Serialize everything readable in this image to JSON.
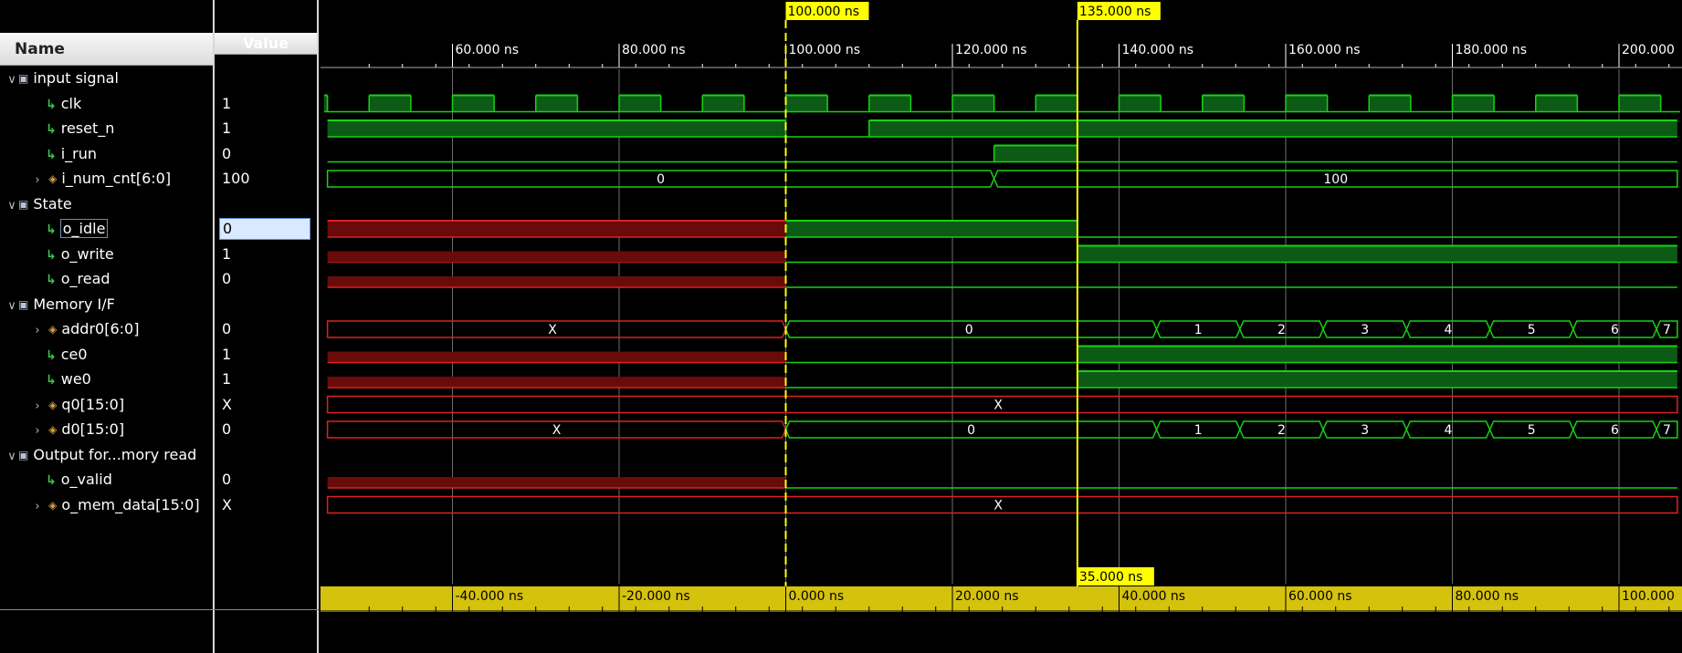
{
  "columns": {
    "name": "Name",
    "value": "Value"
  },
  "groups": [
    {
      "label": "input signal",
      "row": 0
    },
    {
      "label": "State",
      "row": 5
    },
    {
      "label": "Memory I/F",
      "row": 9
    },
    {
      "label": "Output for...mory read",
      "row": 15
    }
  ],
  "signals": [
    {
      "label": "clk",
      "value": "1",
      "kind": "bit",
      "row": 1
    },
    {
      "label": "reset_n",
      "value": "1",
      "kind": "bit",
      "row": 2
    },
    {
      "label": "i_run",
      "value": "0",
      "kind": "bit",
      "row": 3
    },
    {
      "label": "i_num_cnt[6:0]",
      "value": "100",
      "kind": "bus",
      "row": 4
    },
    {
      "label": "o_idle",
      "value": "0",
      "kind": "bit",
      "row": 6,
      "selected": true
    },
    {
      "label": "o_write",
      "value": "1",
      "kind": "bit",
      "row": 7
    },
    {
      "label": "o_read",
      "value": "0",
      "kind": "bit",
      "row": 8
    },
    {
      "label": "addr0[6:0]",
      "value": "0",
      "kind": "bus",
      "row": 10
    },
    {
      "label": "ce0",
      "value": "1",
      "kind": "bit",
      "row": 11
    },
    {
      "label": "we0",
      "value": "1",
      "kind": "bit",
      "row": 12
    },
    {
      "label": "q0[15:0]",
      "value": "X",
      "kind": "bus",
      "row": 13
    },
    {
      "label": "d0[15:0]",
      "value": "0",
      "kind": "bus",
      "row": 14
    },
    {
      "label": "o_valid",
      "value": "0",
      "kind": "bit",
      "row": 16
    },
    {
      "label": "o_mem_data[15:0]",
      "value": "X",
      "kind": "bus",
      "row": 17
    }
  ],
  "cursors": {
    "main": "100.000 ns",
    "secondary": "135.000 ns",
    "delta": "35.000 ns"
  },
  "top_ticks": [
    "60.000 ns",
    "80.000 ns",
    "100.000 ns",
    "120.000 ns",
    "140.000 ns",
    "160.000 ns",
    "180.000 ns",
    "200.000"
  ],
  "bottom_ticks": [
    "-40.000 ns",
    "-20.000 ns",
    "0.000 ns",
    "20.000 ns",
    "40.000 ns",
    "60.000 ns",
    "80.000 ns",
    "100.000"
  ],
  "bus_values": {
    "i_num_cnt": [
      "0",
      "100"
    ],
    "addr0": [
      "X",
      "0",
      "1",
      "2",
      "3",
      "4",
      "5",
      "6",
      "7"
    ],
    "q0": [
      "X"
    ],
    "d0": [
      "X",
      "0",
      "1",
      "2",
      "3",
      "4",
      "5",
      "6",
      "7"
    ],
    "o_mem_data": [
      "X"
    ]
  },
  "colors": {
    "green": "#15d315",
    "green_fill": "#0d5a16",
    "red": "#e02020",
    "red_fill": "#6a0b0b",
    "cursor": "#ffff00",
    "grid": "#6e6e6e"
  }
}
